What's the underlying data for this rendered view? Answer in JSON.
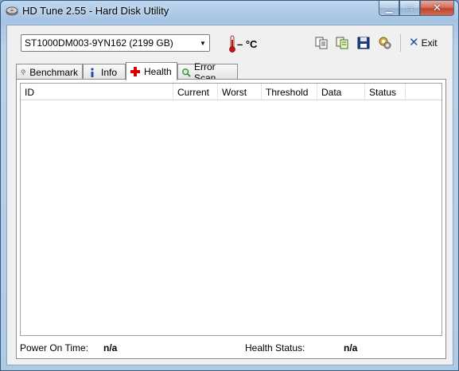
{
  "window": {
    "title": "HD Tune 2.55 - Hard Disk Utility",
    "minimize_glyph": "▁",
    "maximize_glyph": "□",
    "close_glyph": "✕"
  },
  "toolbar": {
    "drive_selected": "ST1000DM003-9YN162 (2199 GB)",
    "temperature": "– °C",
    "icons": [
      "copy-icon",
      "copy-info-icon",
      "save-icon",
      "options-icon"
    ],
    "exit_label": "Exit"
  },
  "tabs": [
    {
      "label": "Benchmark",
      "icon": "benchmark-icon",
      "active": false
    },
    {
      "label": "Info",
      "icon": "info-icon",
      "active": false
    },
    {
      "label": "Health",
      "icon": "health-icon",
      "active": true
    },
    {
      "label": "Error Scan",
      "icon": "error-scan-icon",
      "active": false
    }
  ],
  "health": {
    "columns": [
      "ID",
      "Current",
      "Worst",
      "Threshold",
      "Data",
      "Status"
    ],
    "rows": [],
    "power_on_time_label": "Power On Time:",
    "power_on_time_value": "n/a",
    "health_status_label": "Health Status:",
    "health_status_value": "n/a"
  },
  "colors": {
    "title_bar": "#a6c4e3",
    "close_button": "#c4432f",
    "exit_x": "#1b4fa8",
    "health_cross": "#d40000"
  }
}
